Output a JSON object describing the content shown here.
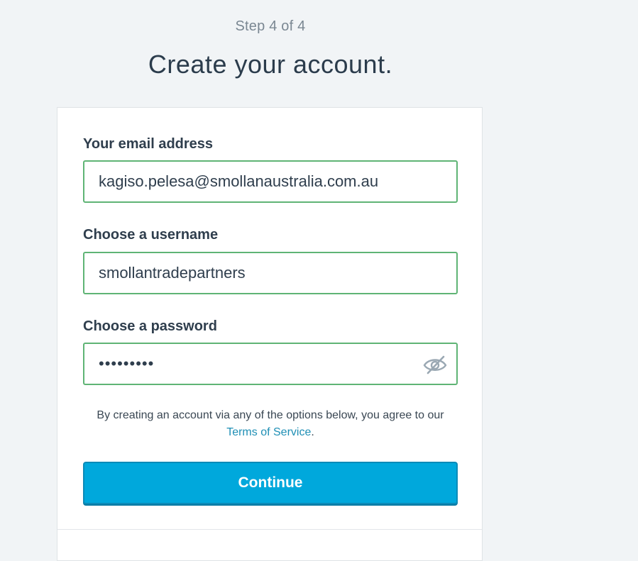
{
  "header": {
    "step": "Step 4 of 4",
    "title": "Create your account."
  },
  "form": {
    "email_label": "Your email address",
    "email_value": "kagiso.pelesa@smollanaustralia.com.au",
    "username_label": "Choose a username",
    "username_value": "smollantradepartners",
    "password_label": "Choose a password",
    "password_value": "•••••••••",
    "password_toggle_icon": "eye-slash-icon"
  },
  "legal": {
    "text": "By creating an account via any of the options below, you agree to our",
    "link_text": "Terms of Service",
    "suffix": "."
  },
  "actions": {
    "continue_label": "Continue"
  },
  "colors": {
    "background": "#f1f4f6",
    "field_border_valid": "#5fb475",
    "primary_button": "#00a8dc",
    "link": "#1f8fb5"
  }
}
